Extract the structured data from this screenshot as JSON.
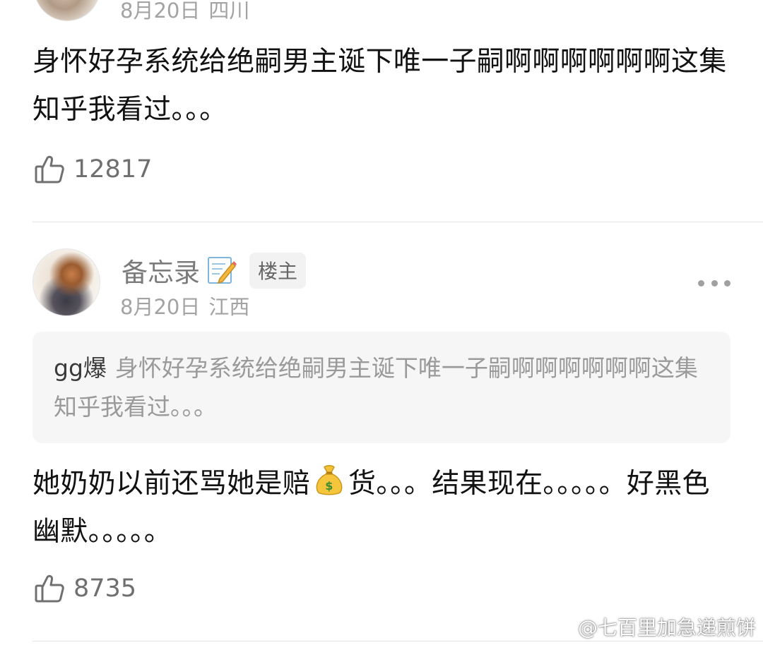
{
  "comment_prev": {
    "date": "8月20日",
    "location": "四川",
    "text": "身怀好孕系统给绝嗣男主诞下唯一子嗣啊啊啊啊啊啊这集知乎我看过。。。",
    "likes": "12817"
  },
  "comment_main": {
    "username": "备忘录",
    "username_emoji": "memo-icon",
    "badge": "楼主",
    "date": "8月20日",
    "location": "江西",
    "quote": {
      "author": "gg爆",
      "text": "身怀好孕系统给绝嗣男主诞下唯一子嗣啊啊啊啊啊啊这集知乎我看过。。。"
    },
    "text_before_emoji": "她奶奶以前还骂她是赔",
    "emoji": "money-bag-icon",
    "text_after_emoji": "货。。。结果现在。。。。。好黑色幽默。。。。。",
    "likes": "8735"
  },
  "watermark": {
    "text": "@七百里加急递煎饼",
    "icon": "weibo-logo"
  },
  "colors": {
    "text_primary": "#121212",
    "text_meta": "#a3a3a3",
    "text_username": "#7b7b7b",
    "quote_bg": "#f6f6f6",
    "divider": "#e4e4e4"
  }
}
